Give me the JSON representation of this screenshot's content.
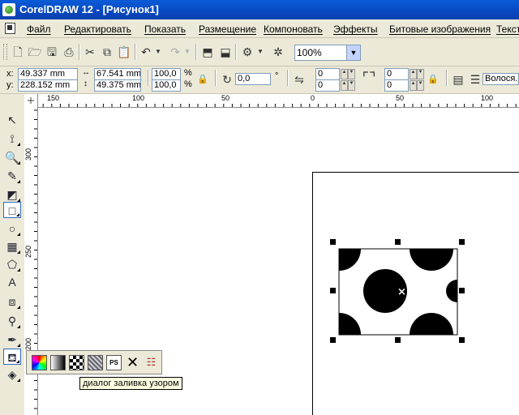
{
  "window": {
    "title": "CorelDRAW 12 - [Рисунок1]"
  },
  "menu": [
    "Файл",
    "Редактировать",
    "Показать",
    "Размещение",
    "Компоновать",
    "Эффекты",
    "Битовые изображения",
    "Текст"
  ],
  "standard_toolbar": {
    "zoom_value": "100%"
  },
  "property_bar": {
    "x_label": "x:",
    "x_value": "49.337 mm",
    "y_label": "y:",
    "y_value": "228.152 mm",
    "width_value": "67.541 mm",
    "height_value": "49.375 mm",
    "scale_w": "100,0",
    "scale_h": "100,0",
    "percent": "%",
    "rotation_value": "0,0",
    "degree": "°",
    "corner_tl": "0",
    "corner_bl": "0",
    "corner_tr": "0",
    "corner_br": "0",
    "outline_value": "Волося..."
  },
  "ruler_top_ticks": [
    "150",
    "100",
    "50",
    "0",
    "50",
    "100"
  ],
  "ruler_left_ticks": [
    "300",
    "250",
    "200"
  ],
  "flyout": {
    "tooltip": "диалог заливка узором"
  },
  "colors": {
    "title_bar": "#0a5bd8",
    "selection_handles": "#000000"
  }
}
